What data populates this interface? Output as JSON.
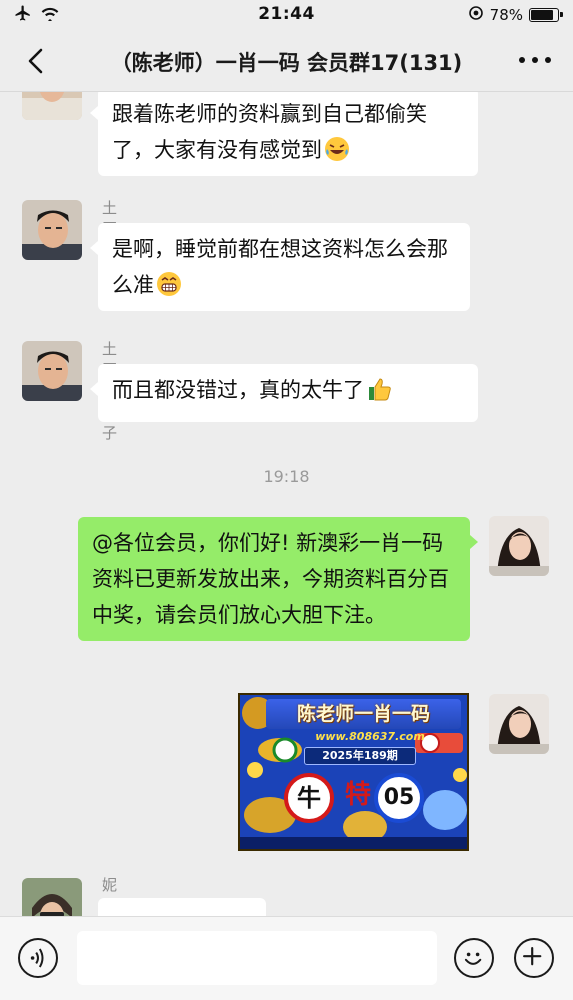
{
  "status_bar": {
    "time": "21:44",
    "battery_percent": "78%",
    "battery_level": 0.78,
    "icons": [
      "airplane-icon",
      "wifi-icon",
      "location-icon",
      "battery-icon"
    ]
  },
  "nav": {
    "title": "（陈老师）一肖一码 会员群17(131)",
    "icons": [
      "back-chevron-icon",
      "more-dots-icon"
    ]
  },
  "messages": [
    {
      "side": "left",
      "sender": "",
      "text": "跟着陈老师的资料赢到自己都偷笑了，大家有没有感觉到",
      "emoji": "laughing-tears-emoji"
    },
    {
      "side": "left",
      "sender": "土匪老爷子",
      "text": "是啊，睡觉前都在想这资料怎么会那么准",
      "emoji": "grinning-emoji"
    },
    {
      "side": "left",
      "sender": "土匪老爷子",
      "text": "而且都没错过，真的太牛了",
      "emoji": "thumbs-up-emoji"
    },
    {
      "type": "time",
      "text": "19:18"
    },
    {
      "side": "right",
      "sender": "",
      "text": "@各位会员，你们好! 新澳彩一肖一码资料已更新发放出来，今期资料百分百中奖，请会员们放心大胆下注。"
    },
    {
      "side": "right",
      "type": "image",
      "promo": {
        "title": "陈老师一肖一码",
        "url": "www.808637.com",
        "issue": "2025年189期",
        "zodiac": "牛",
        "number": "05"
      }
    },
    {
      "side": "left",
      "sender": "妮儿.",
      "text": ""
    }
  ],
  "input_bar": {
    "icons": [
      "voice-icon",
      "emoji-icon",
      "plus-icon"
    ],
    "placeholder": ""
  },
  "colors": {
    "background": "#ededed",
    "bubble_incoming": "#ffffff",
    "bubble_outgoing": "#95ec69",
    "sender_gray": "#8c8c8c"
  }
}
